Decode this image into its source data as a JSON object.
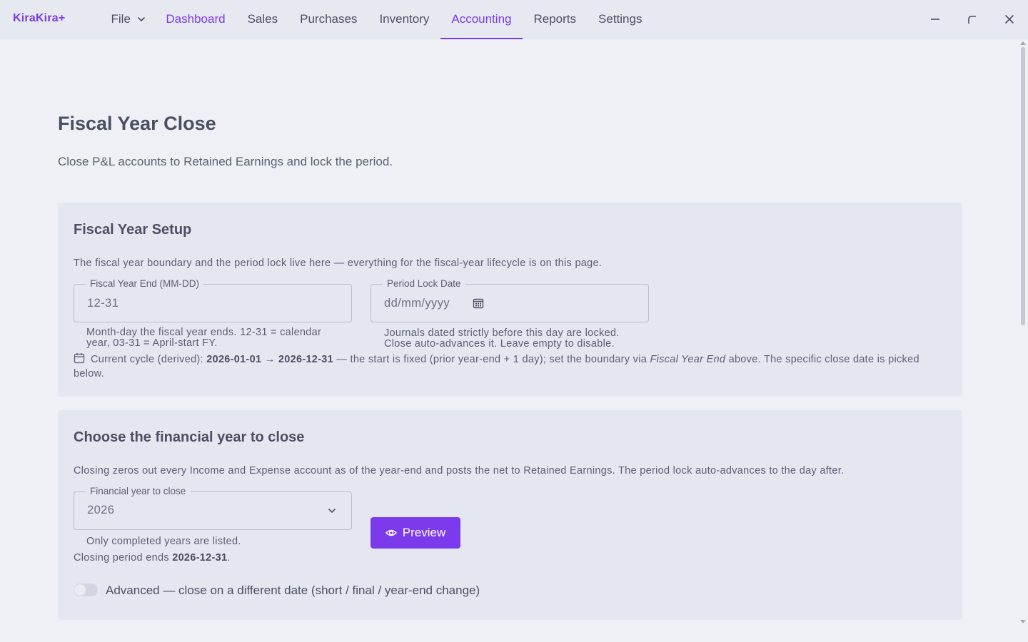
{
  "app": {
    "brand": "KiraKira+"
  },
  "nav": {
    "file": "File",
    "items": [
      "Dashboard",
      "Sales",
      "Purchases",
      "Inventory",
      "Accounting",
      "Reports",
      "Settings"
    ]
  },
  "page": {
    "title": "Fiscal Year Close",
    "subtitle": "Close P&L accounts to Retained Earnings and lock the period."
  },
  "setup": {
    "title": "Fiscal Year Setup",
    "description": "The fiscal year boundary and the period lock live here — everything for the fiscal-year lifecycle is on this page.",
    "fy_end": {
      "label": "Fiscal Year End (MM-DD)",
      "value": "12-31",
      "hint_line1": "Month-day the fiscal year ends. 12-31 = calendar",
      "hint_line2": "year, 03-31 = April-start FY."
    },
    "lock_date": {
      "label": "Period Lock Date",
      "placeholder": "dd/mm/yyyy",
      "hint_line1": "Journals dated strictly before this day are locked.",
      "hint_line2": "Close auto-advances it. Leave empty to disable."
    },
    "cycle": {
      "prefix": "Current cycle (derived): ",
      "start": "2026-01-01",
      "arrow": " → ",
      "end": "2026-12-31",
      "middle": " — the start is fixed (prior year-end + 1 day); set the boundary via ",
      "emphasis": "Fiscal Year End",
      "suffix": " above. The specific close date is picked below."
    }
  },
  "close": {
    "title": "Choose the financial year to close",
    "description": "Closing zeros out every Income and Expense account as of the year-end and posts the net to Retained Earnings. The period lock auto-advances to the day after.",
    "year_select": {
      "label": "Financial year to close",
      "value": "2026",
      "hint": "Only completed years are listed."
    },
    "closing_ends_prefix": "Closing period ends ",
    "closing_ends_date": "2026-12-31",
    "closing_ends_suffix": ".",
    "preview_label": "Preview",
    "advanced_label": "Advanced — close on a different date (short / final / year-end change)"
  },
  "colors": {
    "accent": "#7c3aed",
    "background": "#eef0f5",
    "card": "#e4e7f0"
  }
}
